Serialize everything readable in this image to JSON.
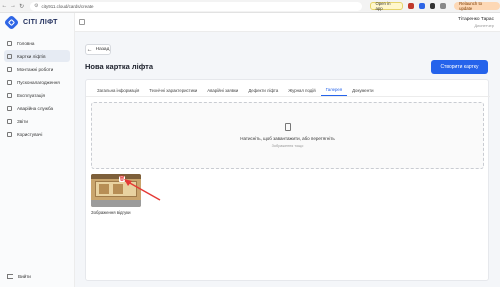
{
  "browser": {
    "url": "city911.cloud/cards/create",
    "open_in_app": "Open in app",
    "update": "Relaunch to update"
  },
  "brand": {
    "name": "CITI ЛІФТ"
  },
  "sidebar": {
    "items": [
      {
        "label": "Головна"
      },
      {
        "label": "Картки ліфтів"
      },
      {
        "label": "Монтажні роботи"
      },
      {
        "label": "Пусконалагодження"
      },
      {
        "label": "Експлуатація"
      },
      {
        "label": "Аварійна служба"
      },
      {
        "label": "Звіти"
      },
      {
        "label": "Користувачі"
      }
    ],
    "logout": "Вийти"
  },
  "user": {
    "name": "Тітаренко Тарас",
    "role": "Диспетчер"
  },
  "page": {
    "back": "Назад",
    "title": "Нова картка ліфта",
    "create": "Створити картку"
  },
  "tabs": [
    {
      "label": "Загальна інформація"
    },
    {
      "label": "Технічні характеристики"
    },
    {
      "label": "Аварійні заявки"
    },
    {
      "label": "Дефекти ліфта"
    },
    {
      "label": "Журнал подій"
    },
    {
      "label": "Галерея"
    },
    {
      "label": "Документи"
    }
  ],
  "gallery": {
    "drop_text": "Натисніть, щоб завантажити, або перетягніть",
    "drop_sub": "Зображення тощо",
    "image_caption": "Зображення відгуки"
  },
  "colors": {
    "accent": "#2563eb",
    "delete": "#e02424",
    "annotation": "#e53935"
  }
}
